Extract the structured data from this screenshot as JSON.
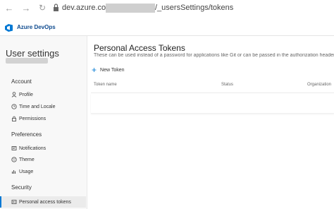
{
  "browser": {
    "url_prefix": "dev.azure.com/",
    "url_suffix": "/_usersSettings/tokens"
  },
  "header": {
    "brand": "Azure DevOps"
  },
  "sidebar": {
    "title": "User settings",
    "sections": [
      {
        "heading": "Account",
        "items": [
          {
            "label": "Profile",
            "icon": "profile-icon"
          },
          {
            "label": "Time and Locale",
            "icon": "clock-icon"
          },
          {
            "label": "Permissions",
            "icon": "lock-icon"
          }
        ]
      },
      {
        "heading": "Preferences",
        "items": [
          {
            "label": "Notifications",
            "icon": "notifications-icon"
          },
          {
            "label": "Theme",
            "icon": "theme-icon"
          },
          {
            "label": "Usage",
            "icon": "usage-icon"
          }
        ]
      },
      {
        "heading": "Security",
        "items": [
          {
            "label": "Personal access tokens",
            "icon": "token-icon",
            "active": true
          }
        ]
      }
    ]
  },
  "main": {
    "title": "Personal Access Tokens",
    "subtitle": "These can be used instead of a password for applications like Git or can be passed in the authorization header",
    "new_token_label": "New Token",
    "columns": [
      "Token name",
      "Status",
      "Organization"
    ]
  },
  "colors": {
    "accent": "#0078d4",
    "brand": "#0f4b8f"
  }
}
